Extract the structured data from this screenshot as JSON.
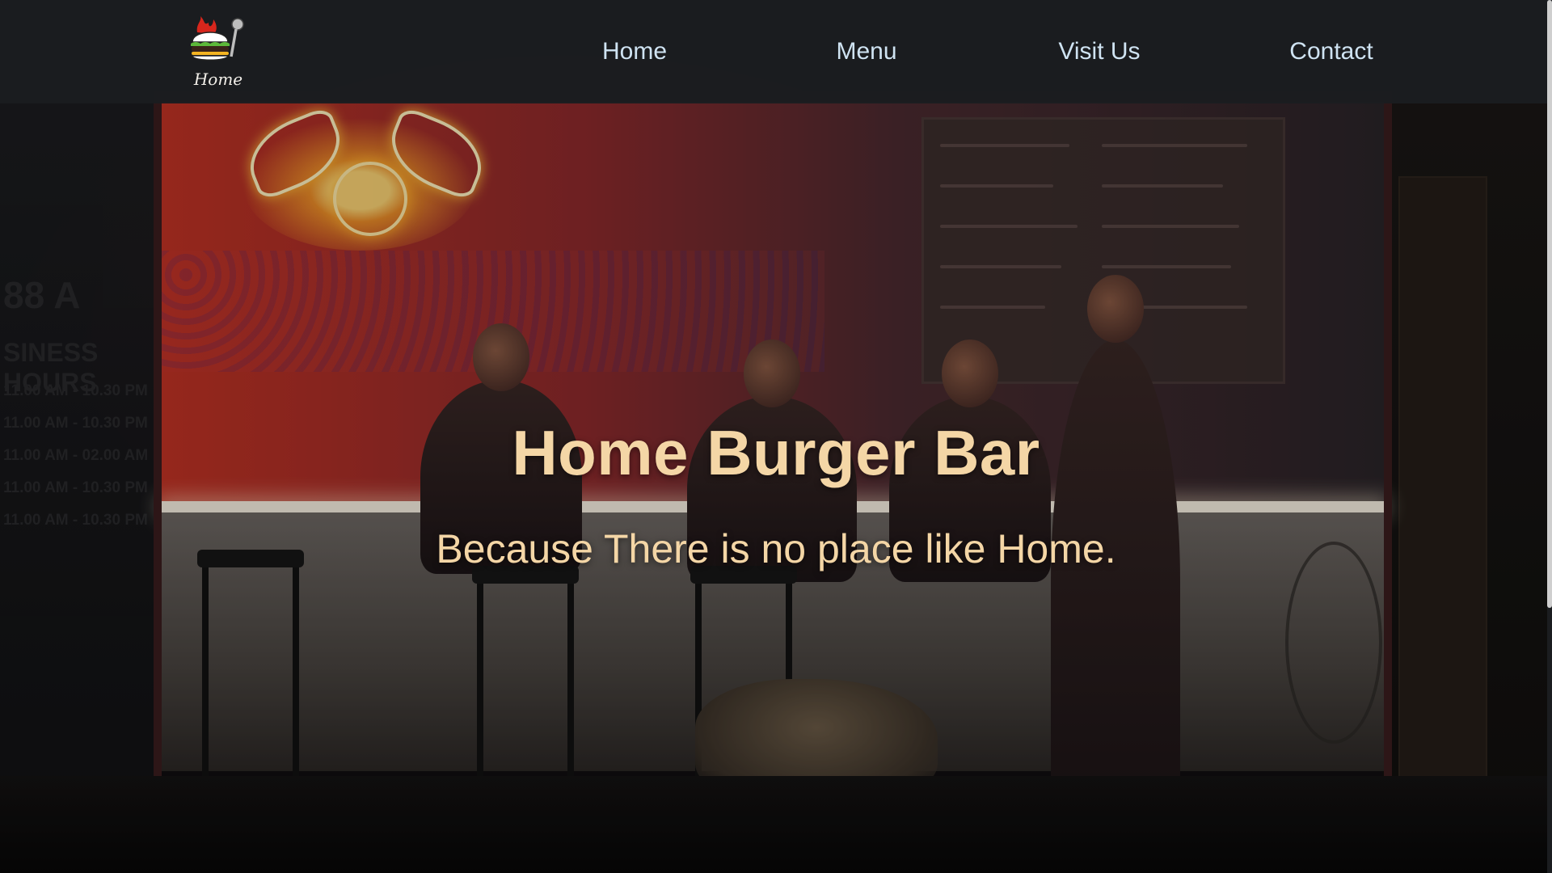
{
  "nav": {
    "logo_text": "Home",
    "links": [
      {
        "label": "Home"
      },
      {
        "label": "Menu"
      },
      {
        "label": "Visit Us"
      },
      {
        "label": "Contact"
      }
    ]
  },
  "hero": {
    "title": "Home Burger Bar",
    "subtitle": "Because There is no place like Home."
  },
  "background_sign": {
    "lines": [
      "88 A",
      "SINESS HOURS",
      "11.00 AM - 10.30 PM",
      "11.00 AM - 10.30 PM",
      "11.00 AM - 02.00 AM",
      "11.00 AM - 10.30 PM",
      "11.00 AM - 10.30 PM"
    ]
  },
  "colors": {
    "nav_background": "#1b1d20",
    "nav_link": "#cfe3f2",
    "hero_text": "#f4d6a6",
    "neon": "#ffb030"
  },
  "icons": {
    "logo": "burger-logo-icon"
  }
}
